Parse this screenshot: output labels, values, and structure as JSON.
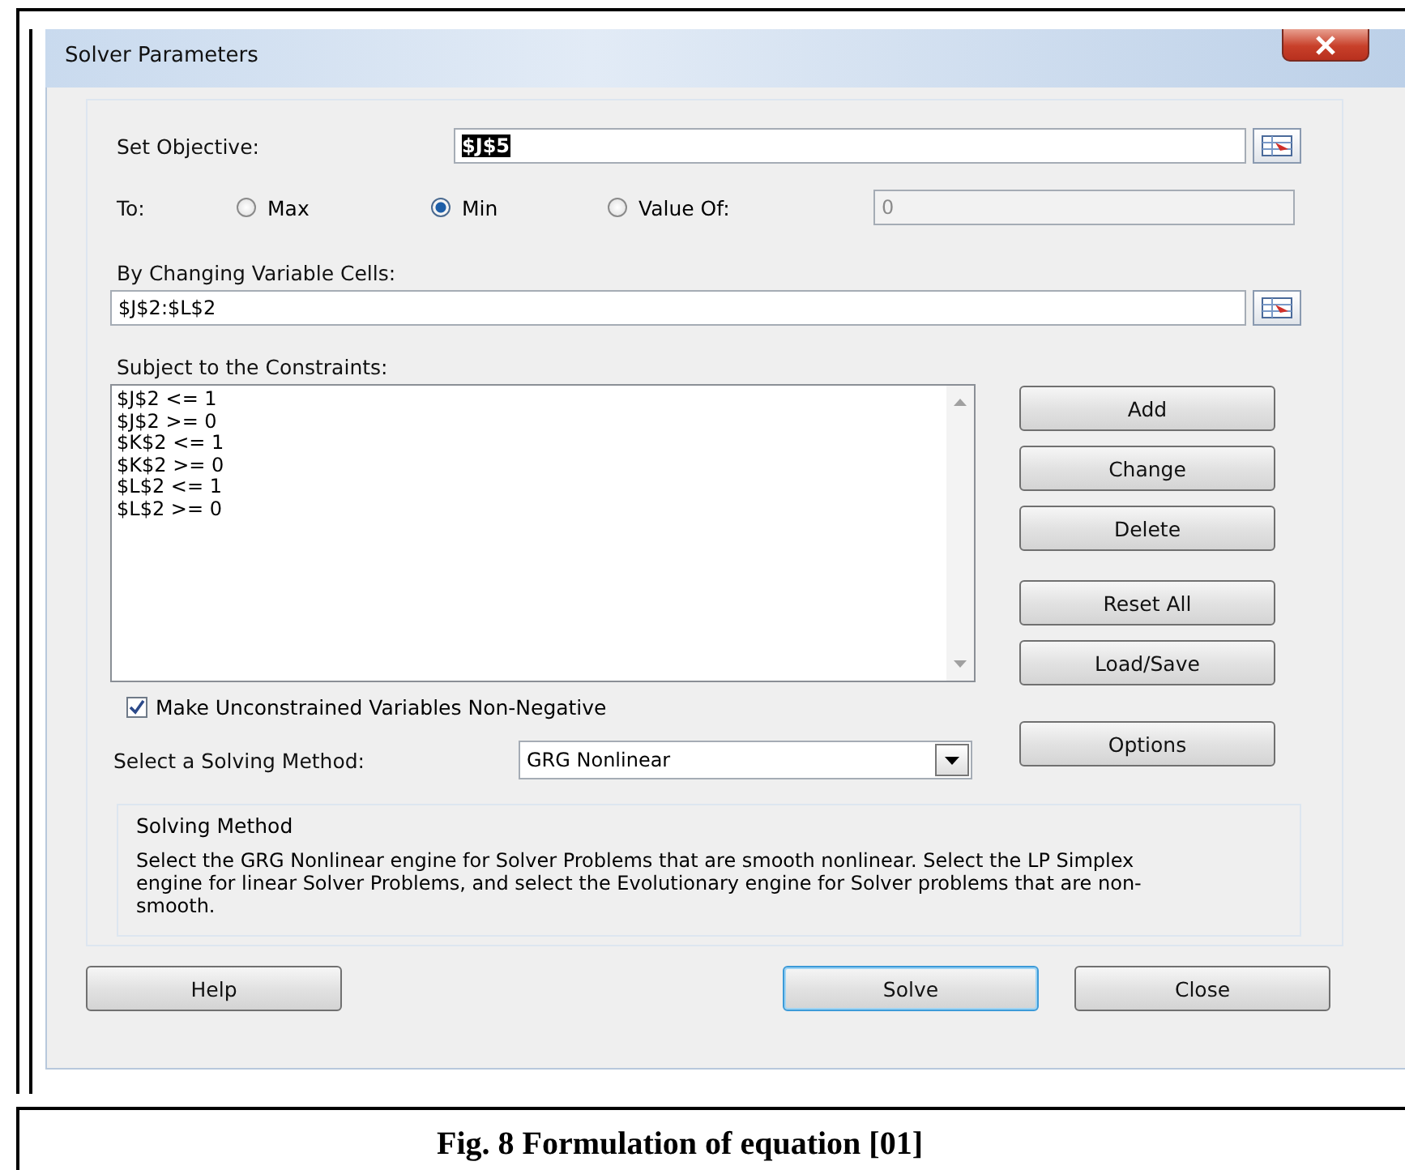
{
  "window": {
    "title": "Solver Parameters"
  },
  "objective": {
    "label": "Set Objective:",
    "value": "$J$5",
    "selected": true
  },
  "to": {
    "label": "To:",
    "options": [
      {
        "label": "Max",
        "selected": false
      },
      {
        "label": "Min",
        "selected": true
      },
      {
        "label": "Value Of:",
        "selected": false
      }
    ],
    "value_field": {
      "value": "0",
      "disabled": true
    }
  },
  "variable_cells": {
    "label": "By Changing Variable Cells:",
    "value": "$J$2:$L$2"
  },
  "constraints": {
    "label": "Subject to the Constraints:",
    "items": [
      "$J$2 <= 1",
      "$J$2 >= 0",
      "$K$2 <= 1",
      "$K$2 >= 0",
      "$L$2 <= 1",
      "$L$2 >= 0"
    ]
  },
  "constraint_button_groups": [
    [
      "Add",
      "Change",
      "Delete"
    ],
    [
      "Reset All",
      "Load/Save"
    ]
  ],
  "non_negative": {
    "label": "Make Unconstrained Variables Non-Negative",
    "checked": true
  },
  "method": {
    "label": "Select a Solving Method:",
    "value": "GRG Nonlinear",
    "button": "Options"
  },
  "method_info": {
    "title": "Solving Method",
    "text": "Select the GRG Nonlinear engine for Solver Problems that are smooth nonlinear. Select the LP Simplex engine for linear Solver Problems, and select the Evolutionary engine for Solver problems that are non-smooth."
  },
  "footer_buttons": [
    {
      "label": "Help",
      "default": false
    },
    {
      "label": "Solve",
      "default": true
    },
    {
      "label": "Close",
      "default": false
    }
  ],
  "caption": "Fig. 8 Formulation of equation [01]"
}
